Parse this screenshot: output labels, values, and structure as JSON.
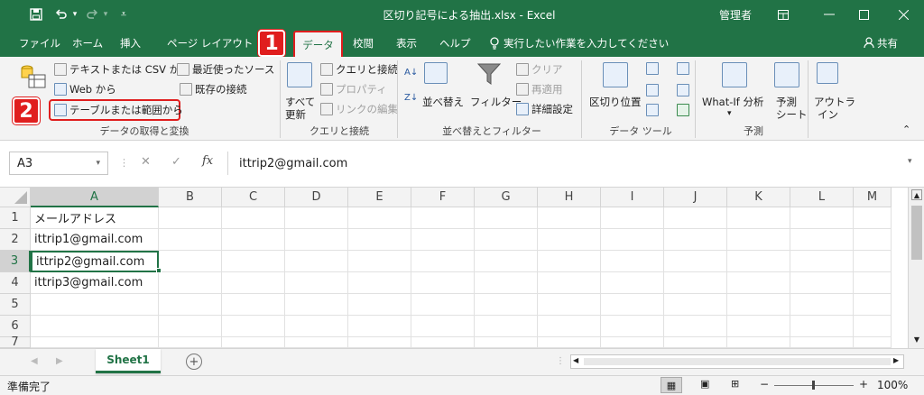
{
  "window": {
    "title": "区切り記号による抽出.xlsx  -  Excel",
    "user": "管理者",
    "save_icon": "save-icon",
    "undo_icon": "undo-icon",
    "redo_icon": "redo-icon"
  },
  "tabs": [
    {
      "label": "ファイル"
    },
    {
      "label": "ホーム"
    },
    {
      "label": "挿入"
    },
    {
      "label": "ページ レイアウト"
    },
    {
      "label": "データ",
      "active": true
    },
    {
      "label": "校閲"
    },
    {
      "label": "表示"
    },
    {
      "label": "ヘルプ"
    }
  ],
  "tell_me": "実行したい作業を入力してください",
  "share": "共有",
  "ribbon": {
    "get_data": {
      "text_csv": "テキストまたは CSV から",
      "recent_sources": "最近使ったソース",
      "web": "Web から",
      "existing_conn": "既存の接続",
      "from_table": "テーブルまたは範囲から",
      "label": "データの取得と変換"
    },
    "queries": {
      "refresh_all_1": "すべて",
      "refresh_all_2": "更新",
      "queries_conn": "クエリと接続",
      "properties": "プロパティ",
      "edit_links": "リンクの編集",
      "label": "クエリと接続"
    },
    "sort_filter": {
      "sort": "並べ替え",
      "filter": "フィルター",
      "clear": "クリア",
      "reapply": "再適用",
      "advanced": "詳細設定",
      "label": "並べ替えとフィルター"
    },
    "data_tools": {
      "text_to_columns": "区切り位置",
      "label": "データ ツール"
    },
    "forecast": {
      "what_if": "What-If 分析",
      "forecast_1": "予測",
      "forecast_2": "シート",
      "label": "予測"
    },
    "outline": {
      "outline_1": "アウトラ",
      "outline_2": "イン"
    }
  },
  "markers": {
    "one": "1",
    "two": "2"
  },
  "formula_bar": {
    "name_box": "A3",
    "fx": "fx",
    "value": "ittrip2@gmail.com"
  },
  "columns": [
    "A",
    "B",
    "C",
    "D",
    "E",
    "F",
    "G",
    "H",
    "I",
    "J",
    "K",
    "L",
    "M"
  ],
  "rows": [
    {
      "num": "1",
      "a": "メールアドレス"
    },
    {
      "num": "2",
      "a": "ittrip1@gmail.com"
    },
    {
      "num": "3",
      "a": "ittrip2@gmail.com"
    },
    {
      "num": "4",
      "a": "ittrip3@gmail.com"
    },
    {
      "num": "5",
      "a": ""
    },
    {
      "num": "6",
      "a": ""
    },
    {
      "num": "7",
      "a": ""
    }
  ],
  "sheet_tab": "Sheet1",
  "status": {
    "ready": "準備完了",
    "zoom": "100%"
  },
  "colors": {
    "excel_green": "#217346",
    "marker_red": "#e01e1e"
  }
}
